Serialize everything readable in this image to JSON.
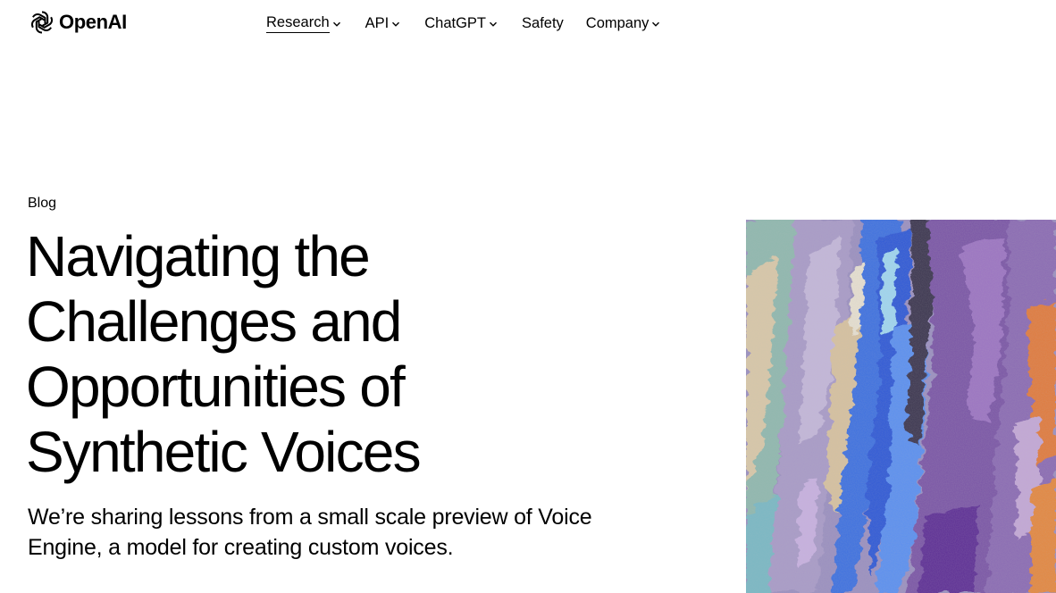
{
  "brand": {
    "name": "OpenAI",
    "logo_icon": "openai-knot-icon"
  },
  "nav": {
    "items": [
      {
        "label": "Research",
        "has_dropdown": true,
        "active": true
      },
      {
        "label": "API",
        "has_dropdown": true,
        "active": false
      },
      {
        "label": "ChatGPT",
        "has_dropdown": true,
        "active": false
      },
      {
        "label": "Safety",
        "has_dropdown": false,
        "active": false
      },
      {
        "label": "Company",
        "has_dropdown": true,
        "active": false
      }
    ]
  },
  "article": {
    "category": "Blog",
    "title": "Navigating the Challenges and Opportunities of Synthetic Voices",
    "subtitle": "We’re sharing lessons from a small scale preview of Voice Engine, a model for creating custom voices."
  },
  "hero_image": {
    "icon": "abstract-painting-image",
    "palette": [
      "#8f86b5",
      "#3f6fe0",
      "#86b7b0",
      "#d9c3a3",
      "#6a3f8f",
      "#2b2b2b",
      "#e0793a",
      "#b59bc9"
    ]
  }
}
